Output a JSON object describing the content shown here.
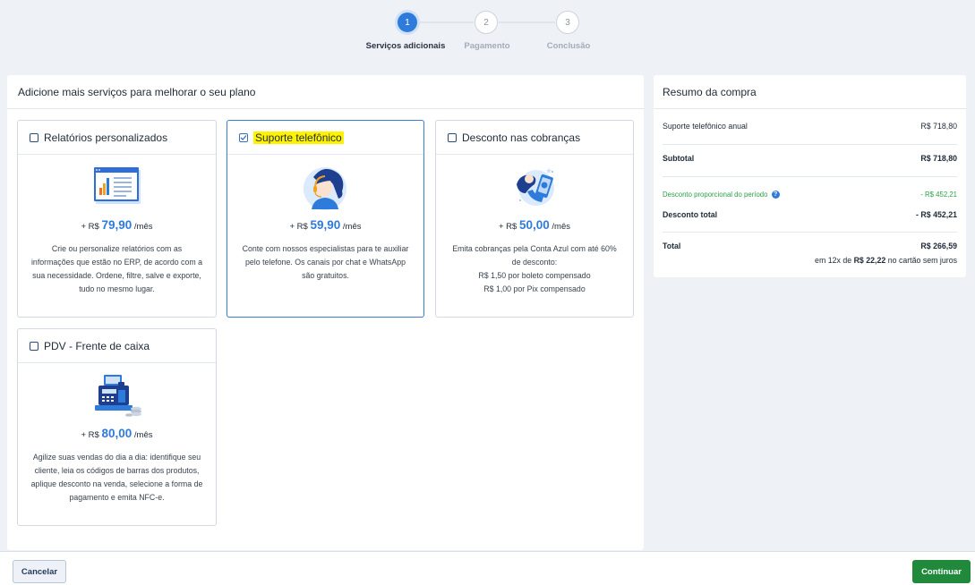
{
  "stepper": {
    "steps": [
      {
        "number": "1",
        "label": "Serviços adicionais"
      },
      {
        "number": "2",
        "label": "Pagamento"
      },
      {
        "number": "3",
        "label": "Conclusão"
      }
    ]
  },
  "services": {
    "title": "Adicione mais serviços para melhorar o seu plano",
    "price_prefix": "+ R$",
    "price_suffix": "/mês",
    "cards": [
      {
        "name": "Relatórios personalizados",
        "checked": false,
        "amount": "79,90",
        "icon": "report-icon",
        "desc": [
          "Crie ou personalize relatórios com as",
          "informações que estão no ERP, de acordo com a",
          "sua necessidade. Ordene, filtre, salve e exporte,",
          "tudo no mesmo lugar."
        ]
      },
      {
        "name": "Suporte telefônico",
        "checked": true,
        "amount": "59,90",
        "icon": "support-agent-icon",
        "desc": [
          "Conte com nossos especialistas para te auxiliar",
          "pelo telefone. Os canais por chat e WhatsApp",
          "são gratuitos."
        ]
      },
      {
        "name": "Desconto nas cobranças",
        "checked": false,
        "amount": "50,00",
        "icon": "mobile-payment-icon",
        "desc": [
          "Emita cobranças pela Conta Azul com até 60%",
          "de desconto:",
          "R$ 1,50 por boleto compensado",
          "R$ 1,00 por Pix compensado"
        ]
      },
      {
        "name": "PDV - Frente de caixa",
        "checked": false,
        "amount": "80,00",
        "icon": "cash-register-icon",
        "desc": [
          "Agilize suas vendas do dia a dia: identifique seu",
          "cliente, leia os códigos de barras dos produtos,",
          "aplique desconto na venda, selecione a forma de",
          "pagamento e emita NFC-e."
        ]
      }
    ]
  },
  "summary": {
    "title": "Resumo da compra",
    "item_label": "Suporte telefônico anual",
    "item_value": "R$ 718,80",
    "subtotal_label": "Subtotal",
    "subtotal_value": "R$ 718,80",
    "prorata_label": "Desconto proporcional do período",
    "prorata_value": "- R$ 452,21",
    "discount_label": "Desconto total",
    "discount_value": "- R$ 452,21",
    "total_label": "Total",
    "total_value": "R$ 266,59",
    "installments_prefix": "em 12x de",
    "installments_value": "R$ 22,22",
    "installments_suffix": "no cartão sem juros"
  },
  "footer": {
    "cancel_label": "Cancelar",
    "continue_label": "Continuar"
  },
  "colors": {
    "accent": "#2f7bdc",
    "success": "#21893b",
    "highlight": "#fff200"
  }
}
